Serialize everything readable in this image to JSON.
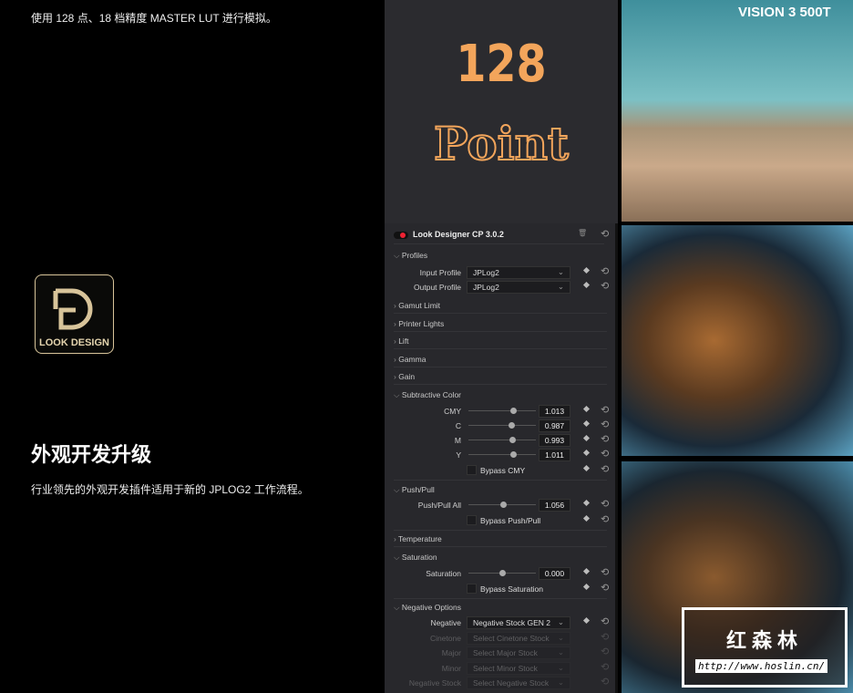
{
  "left": {
    "top_note": "使用 128 点、18 档精度 MASTER LUT 进行模拟。",
    "logo_text": "LOOK DESIGN",
    "heading": "外观开发升级",
    "subtitle": "行业领先的外观开发插件适用于新的 JPLOG2 工作流程。"
  },
  "promo": {
    "line1": "128",
    "line2": "Point"
  },
  "panel": {
    "title": "Look Designer CP 3.0.2",
    "profiles": "Profiles",
    "input_profile_label": "Input Profile",
    "input_profile": "JPLog2",
    "output_profile_label": "Output Profile",
    "output_profile": "JPLog2",
    "gamut": "Gamut Limit",
    "printer": "Printer Lights",
    "lift": "Lift",
    "gamma": "Gamma",
    "gain": "Gain",
    "subtractive": "Subtractive Color",
    "cmy": {
      "label": "CMY",
      "value": "1.013",
      "pos": 0.66
    },
    "c": {
      "label": "C",
      "value": "0.987",
      "pos": 0.64
    },
    "m": {
      "label": "M",
      "value": "0.993",
      "pos": 0.65
    },
    "y": {
      "label": "Y",
      "value": "1.011",
      "pos": 0.66
    },
    "bypass_cmy": "Bypass CMY",
    "pushpull": "Push/Pull",
    "pushpull_all": {
      "label": "Push/Pull All",
      "value": "1.056",
      "pos": 0.52
    },
    "bypass_pushpull": "Bypass Push/Pull",
    "temperature": "Temperature",
    "saturation": "Saturation",
    "saturation_ctrl": {
      "label": "Saturation",
      "value": "0.000",
      "pos": 0.5
    },
    "bypass_saturation": "Bypass Saturation",
    "negative_options": "Negative Options",
    "negative_label": "Negative",
    "negative": "Negative Stock GEN 2",
    "cinetone_label": "Cinetone",
    "cinetone": "Select Cinetone Stock",
    "major_label": "Major",
    "major": "Select Major Stock",
    "minor_label": "Minor",
    "minor": "Select Minor Stock",
    "negstock_label": "Negative Stock",
    "negstock": "Select Negative Stock"
  },
  "images": {
    "film_label": "VISION 3 500T"
  },
  "watermark": {
    "title": "红森林",
    "url": "http://www.hoslin.cn/"
  }
}
